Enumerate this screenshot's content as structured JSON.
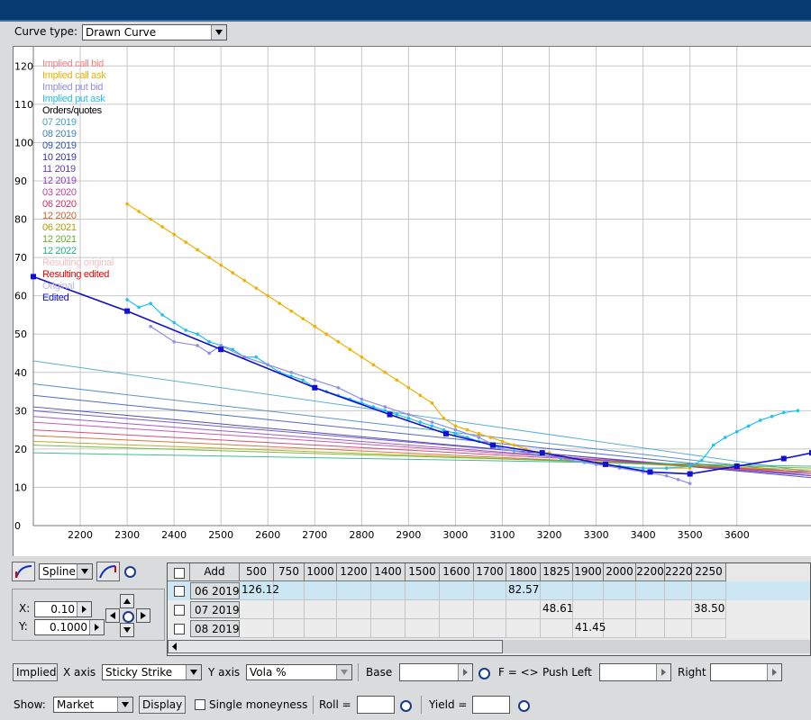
{
  "curve_type": {
    "label": "Curve type:",
    "value": "Drawn Curve"
  },
  "chart_data": {
    "type": "line",
    "title": "",
    "xlabel": "",
    "ylabel": "",
    "xlim": [
      2100,
      3760
    ],
    "ylim": [
      0,
      125
    ],
    "x_ticks": [
      2200,
      2300,
      2400,
      2500,
      2600,
      2700,
      2800,
      2900,
      3000,
      3100,
      3200,
      3300,
      3400,
      3500,
      3600
    ],
    "y_ticks": [
      0,
      10,
      20,
      30,
      40,
      50,
      60,
      70,
      80,
      90,
      100,
      110,
      120
    ],
    "grid": true,
    "legend_position": "top-left",
    "legend": [
      {
        "name": "Implied call bid",
        "color": "#f08080"
      },
      {
        "name": "Implied call ask",
        "color": "#f0b000"
      },
      {
        "name": "Implied put bid",
        "color": "#9090e0"
      },
      {
        "name": "Implied put ask",
        "color": "#20c0f0"
      },
      {
        "name": "Orders/quotes",
        "color": "#000000"
      },
      {
        "name": "07 2019",
        "color": "#40a0d0"
      },
      {
        "name": "08 2019",
        "color": "#4080c0"
      },
      {
        "name": "09 2019",
        "color": "#3050c0"
      },
      {
        "name": "10 2019",
        "color": "#3030b0"
      },
      {
        "name": "11 2019",
        "color": "#6040c0"
      },
      {
        "name": "12 2019",
        "color": "#9040c0"
      },
      {
        "name": "03 2020",
        "color": "#c040a0"
      },
      {
        "name": "06 2020",
        "color": "#d03060"
      },
      {
        "name": "12 2020",
        "color": "#d06020"
      },
      {
        "name": "06 2021",
        "color": "#b0a000"
      },
      {
        "name": "12 2021",
        "color": "#60b020"
      },
      {
        "name": "12 2022",
        "color": "#20b080"
      },
      {
        "name": "Resulting original",
        "color": "#f0c0c0"
      },
      {
        "name": "Resulting edited",
        "color": "#f00000"
      },
      {
        "name": "Original",
        "color": "#b8b8e8"
      },
      {
        "name": "Edited",
        "color": "#1010d0"
      }
    ],
    "series": [
      {
        "name": "Implied call ask",
        "color": "#f0b000",
        "x": [
          2300,
          2325,
          2350,
          2375,
          2400,
          2425,
          2450,
          2475,
          2500,
          2525,
          2550,
          2575,
          2600,
          2625,
          2650,
          2675,
          2700,
          2725,
          2750,
          2775,
          2800,
          2825,
          2850,
          2875,
          2900,
          2925,
          2950,
          2975,
          3000,
          3025,
          3050,
          3075,
          3100,
          3125,
          3150,
          3175,
          3200,
          3225,
          3250,
          3275,
          3300,
          3325,
          3350,
          3400,
          3450,
          3500
        ],
        "y": [
          84,
          82,
          80,
          78,
          76,
          74,
          72,
          70,
          68,
          66,
          64,
          62,
          60,
          58,
          56,
          54,
          52,
          50,
          48,
          46,
          44,
          42,
          40,
          38,
          36,
          34,
          32,
          28,
          26,
          25,
          24,
          23,
          22,
          21,
          20,
          19,
          19,
          18,
          17.5,
          17,
          16.5,
          16,
          15.5,
          15,
          15,
          15
        ]
      },
      {
        "name": "Implied put ask",
        "color": "#20c0f0",
        "x": [
          2300,
          2325,
          2350,
          2375,
          2400,
          2425,
          2450,
          2475,
          2500,
          2525,
          2550,
          2575,
          2600,
          2625,
          2650,
          2675,
          2700,
          2725,
          2750,
          2775,
          2800,
          2825,
          2850,
          2875,
          2900,
          2925,
          2950,
          2975,
          3000,
          3025,
          3050,
          3075,
          3100,
          3125,
          3150,
          3175,
          3200,
          3225,
          3250,
          3275,
          3300,
          3350,
          3400,
          3450,
          3500,
          3525,
          3550,
          3575,
          3600,
          3625,
          3650,
          3675,
          3700,
          3730
        ],
        "y": [
          59,
          57,
          58,
          55,
          53,
          51,
          50,
          48,
          47,
          46,
          44,
          44,
          42,
          40,
          39,
          38,
          36,
          35,
          34,
          33,
          32,
          31,
          30,
          29,
          28,
          27,
          26,
          25,
          24,
          23,
          22,
          21,
          20,
          19.5,
          19,
          18.5,
          18,
          17.5,
          17,
          16.5,
          16,
          15.5,
          15,
          15,
          15.5,
          17,
          21,
          23,
          24.5,
          26,
          27.5,
          28.5,
          29.5,
          30
        ]
      },
      {
        "name": "Implied put bid",
        "color": "#9090e0",
        "x": [
          2350,
          2400,
          2450,
          2475,
          2500,
          2550,
          2600,
          2650,
          2700,
          2750,
          2800,
          2850,
          2900,
          2950,
          3000,
          3050,
          3100,
          3150,
          3200,
          3250,
          3300,
          3350,
          3400,
          3450,
          3475,
          3500
        ],
        "y": [
          52,
          48,
          47,
          45,
          47,
          44,
          42,
          40,
          38,
          36,
          33,
          31,
          29,
          27,
          25,
          23,
          20,
          19,
          18,
          17,
          16,
          15,
          14,
          13,
          12,
          11
        ]
      },
      {
        "name": "Edited",
        "color": "#1010d0",
        "x": [
          2100,
          2300,
          2500,
          2700,
          2860,
          2980,
          3080,
          3185,
          3320,
          3415,
          3500,
          3600,
          3700,
          3760
        ],
        "y": [
          65,
          56,
          46,
          36,
          29,
          24,
          21,
          19,
          16,
          14,
          13.5,
          15.5,
          17.5,
          19
        ]
      },
      {
        "name": "07 2019",
        "color": "#40a0d0",
        "x": [
          2100,
          3760
        ],
        "y": [
          43,
          14
        ]
      },
      {
        "name": "08 2019",
        "color": "#4080c0",
        "x": [
          2100,
          3760
        ],
        "y": [
          37,
          13.5
        ]
      },
      {
        "name": "09 2019",
        "color": "#3050c0",
        "x": [
          2100,
          3760
        ],
        "y": [
          34,
          13
        ]
      },
      {
        "name": "10 2019",
        "color": "#3030b0",
        "x": [
          2100,
          3760
        ],
        "y": [
          31,
          12.5
        ]
      },
      {
        "name": "11 2019",
        "color": "#6040c0",
        "x": [
          2100,
          3760
        ],
        "y": [
          30,
          13
        ]
      },
      {
        "name": "12 2019",
        "color": "#9040c0",
        "x": [
          2100,
          3760
        ],
        "y": [
          28.5,
          13
        ]
      },
      {
        "name": "03 2020",
        "color": "#c040a0",
        "x": [
          2100,
          3760
        ],
        "y": [
          27,
          13.5
        ]
      },
      {
        "name": "06 2020",
        "color": "#d03060",
        "x": [
          2100,
          3760
        ],
        "y": [
          25,
          14
        ]
      },
      {
        "name": "12 2020",
        "color": "#d06020",
        "x": [
          2100,
          3760
        ],
        "y": [
          23.5,
          14
        ]
      },
      {
        "name": "06 2021",
        "color": "#b0a000",
        "x": [
          2100,
          3760
        ],
        "y": [
          22,
          14.5
        ]
      },
      {
        "name": "12 2021",
        "color": "#60b020",
        "x": [
          2100,
          3760
        ],
        "y": [
          21,
          15
        ]
      },
      {
        "name": "12 2022",
        "color": "#20b080",
        "x": [
          2100,
          3760
        ],
        "y": [
          19,
          15.5
        ]
      }
    ]
  },
  "controls": {
    "spline_value": "Spline",
    "x_label": "X:",
    "x_value": "0.10",
    "y_label": "Y:",
    "y_value": "0.1000"
  },
  "table": {
    "add_label": "Add",
    "columns": [
      "500",
      "750",
      "1000",
      "1200",
      "1400",
      "1500",
      "1600",
      "1700",
      "1800",
      "1825",
      "1900",
      "2000",
      "2200",
      "2220",
      "2250"
    ],
    "rows": [
      {
        "label": "06 2019",
        "cells": {
          "0": "126.12",
          "8": "82.57"
        },
        "selected": true
      },
      {
        "label": "07 2019",
        "cells": {
          "9": "48.61",
          "14": "38.50"
        },
        "selected": false
      },
      {
        "label": "08 2019",
        "cells": {
          "10": "41.45"
        },
        "selected": false
      }
    ]
  },
  "toolbar1": {
    "implied": "Implied",
    "xaxis_label": "X axis",
    "xaxis_value": "Sticky Strike",
    "yaxis_label": "Y axis",
    "yaxis_value": "Vola %",
    "base_label": "Base",
    "f_label": "F = <>",
    "push_left_label": "Push Left",
    "right_label": "Right"
  },
  "toolbar2": {
    "show_label": "Show:",
    "show_value": "Market",
    "display_label": "Display",
    "single_moneyness_label": "Single moneyness",
    "roll_label": "Roll =",
    "yield_label": "Yield ="
  }
}
